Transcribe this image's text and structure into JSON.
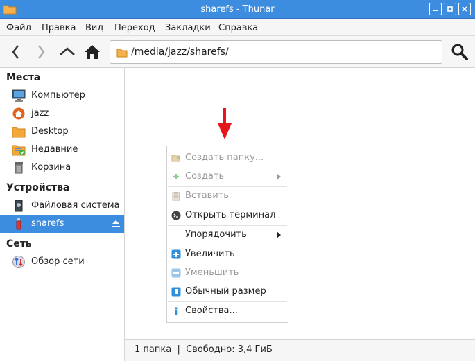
{
  "window": {
    "title": "sharefs - Thunar"
  },
  "menubar": {
    "items": [
      "Файл",
      "Правка",
      "Вид",
      "Переход",
      "Закладки",
      "Справка"
    ]
  },
  "location": {
    "path": "/media/jazz/sharefs/"
  },
  "sidebar": {
    "places_header": "Места",
    "places": [
      "Компьютер",
      "jazz",
      "Desktop",
      "Недавние",
      "Корзина"
    ],
    "devices_header": "Устройства",
    "devices": [
      "Файловая система",
      "sharefs"
    ],
    "network_header": "Сеть",
    "network": [
      "Обзор сети"
    ]
  },
  "context_menu": {
    "create_folder": "Создать папку...",
    "create": "Создать",
    "paste": "Вставить",
    "open_terminal": "Открыть терминал",
    "arrange": "Упорядочить",
    "zoom_in": "Увеличить",
    "zoom_out": "Уменьшить",
    "normal_size": "Обычный размер",
    "properties": "Свойства..."
  },
  "status": {
    "text": "1 папка  |  Свободно: 3,4 ГиБ"
  },
  "colors": {
    "accent": "#3c8ce0",
    "arrow": "#e8141b"
  }
}
